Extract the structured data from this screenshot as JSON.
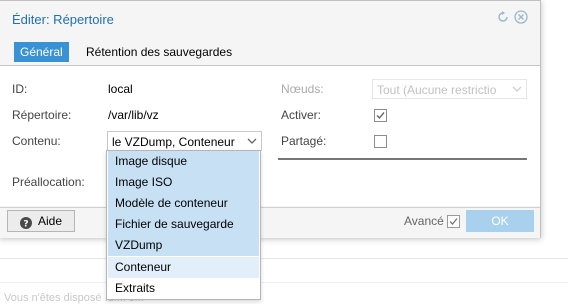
{
  "window": {
    "title": "Éditer: Répertoire",
    "tabs": [
      {
        "label": "Général",
        "active": true
      },
      {
        "label": "Rétention des sauvegardes",
        "active": false
      }
    ]
  },
  "form": {
    "id": {
      "label": "ID:",
      "value": "local"
    },
    "directory": {
      "label": "Répertoire:",
      "value": "/var/lib/vz"
    },
    "content": {
      "label": "Contenu:",
      "value": "le VZDump, Conteneur"
    },
    "nodes": {
      "label": "Nœuds:",
      "value": "Tout (Aucune restrictio"
    },
    "enable": {
      "label": "Activer:",
      "checked": true
    },
    "shared": {
      "label": "Partagé:",
      "checked": false
    },
    "preallocation": {
      "label": "Préallocation:"
    }
  },
  "footer": {
    "help_label": "Aide",
    "advanced_label": "Avancé",
    "advanced_checked": true,
    "ok_label": "OK"
  },
  "dropdown": {
    "options": [
      {
        "label": "Image disque",
        "selected": true
      },
      {
        "label": "Image ISO",
        "selected": true
      },
      {
        "label": "Modèle de conteneur",
        "selected": true
      },
      {
        "label": "Fichier de sauvegarde",
        "selected": true
      },
      {
        "label": "VZDump",
        "selected": true
      },
      {
        "label": "Conteneur",
        "selected": false,
        "hover": true
      },
      {
        "label": "Extraits",
        "selected": false
      }
    ]
  },
  "background": {
    "partial_text": "Vous n'êtes disposé .d.... s..."
  },
  "colors": {
    "accent": "#3892d4",
    "title": "#1f6fb5",
    "selected_option": "#c7e0f4",
    "ok_button": "#a9d1ee"
  }
}
